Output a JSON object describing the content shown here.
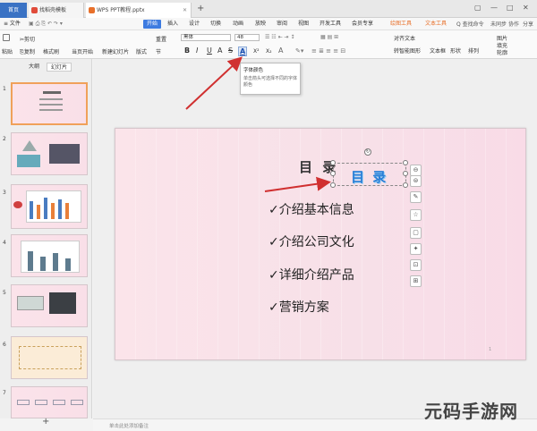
{
  "titlebar": {
    "home": "首页",
    "tabs": [
      {
        "label": "找稻壳模板",
        "color": "#e04b3a"
      },
      {
        "label": "WPS PPT教程.pptx",
        "color": "#e8702a"
      }
    ],
    "add": "+",
    "controls": [
      "▢",
      "—",
      "□",
      "✕"
    ]
  },
  "menubar": {
    "file": "≡ 文件",
    "items": [
      "开始",
      "插入",
      "设计",
      "切换",
      "动画",
      "放映",
      "审阅",
      "视图",
      "开发工具",
      "会员专享",
      "绘图工具",
      "文本工具"
    ],
    "active": "开始",
    "search": "Q 查找命令",
    "right": [
      "未同步",
      "协作",
      "分享"
    ]
  },
  "ribbon": {
    "paste": "粘贴",
    "cut": "剪切",
    "copy": "复制",
    "format_painter": "格式刷",
    "from_current": "当页开始",
    "new_slide": "新建幻灯片",
    "layout": "版式",
    "section": "节",
    "reset": "重置",
    "font": "黑体",
    "size": "48",
    "text_box": "文本框",
    "shape": "形状",
    "arrange": "排列",
    "picture": "图片",
    "fill": "填充",
    "outline": "轮廓",
    "align_text": "对齐文本",
    "convert_smartart": "转智能图形",
    "text_direction": "文字方向",
    "format_buttons": [
      "B",
      "I",
      "U",
      "A",
      "S",
      "A",
      "X²",
      "X₂",
      "A"
    ]
  },
  "tooltip": {
    "title": "字体颜色",
    "desc": "单击箭头可选择不同的字体颜色"
  },
  "leftpanel": {
    "tabs": [
      "大纲",
      "幻灯片"
    ],
    "active": "幻灯片",
    "slides": [
      "1",
      "2",
      "3",
      "4",
      "5",
      "6",
      "7"
    ],
    "add": "+"
  },
  "slide": {
    "title": "目 录",
    "wordart": "目 录",
    "bullets": [
      "✓介绍基本信息",
      "✓介绍公司文化",
      "✓详细介绍产品",
      "✓营销方案"
    ],
    "page_num": "1"
  },
  "sidetools": [
    "⊖",
    "⊜",
    "✎",
    "☆",
    "▢",
    "✦",
    "⊡",
    "⊞"
  ],
  "notes": {
    "placeholder": "单击此处添加备注"
  },
  "watermark": "元码手游网",
  "colors": {
    "accent": "#3d7be0",
    "arrow": "#d03030",
    "wordart": "#2a7fd6"
  }
}
